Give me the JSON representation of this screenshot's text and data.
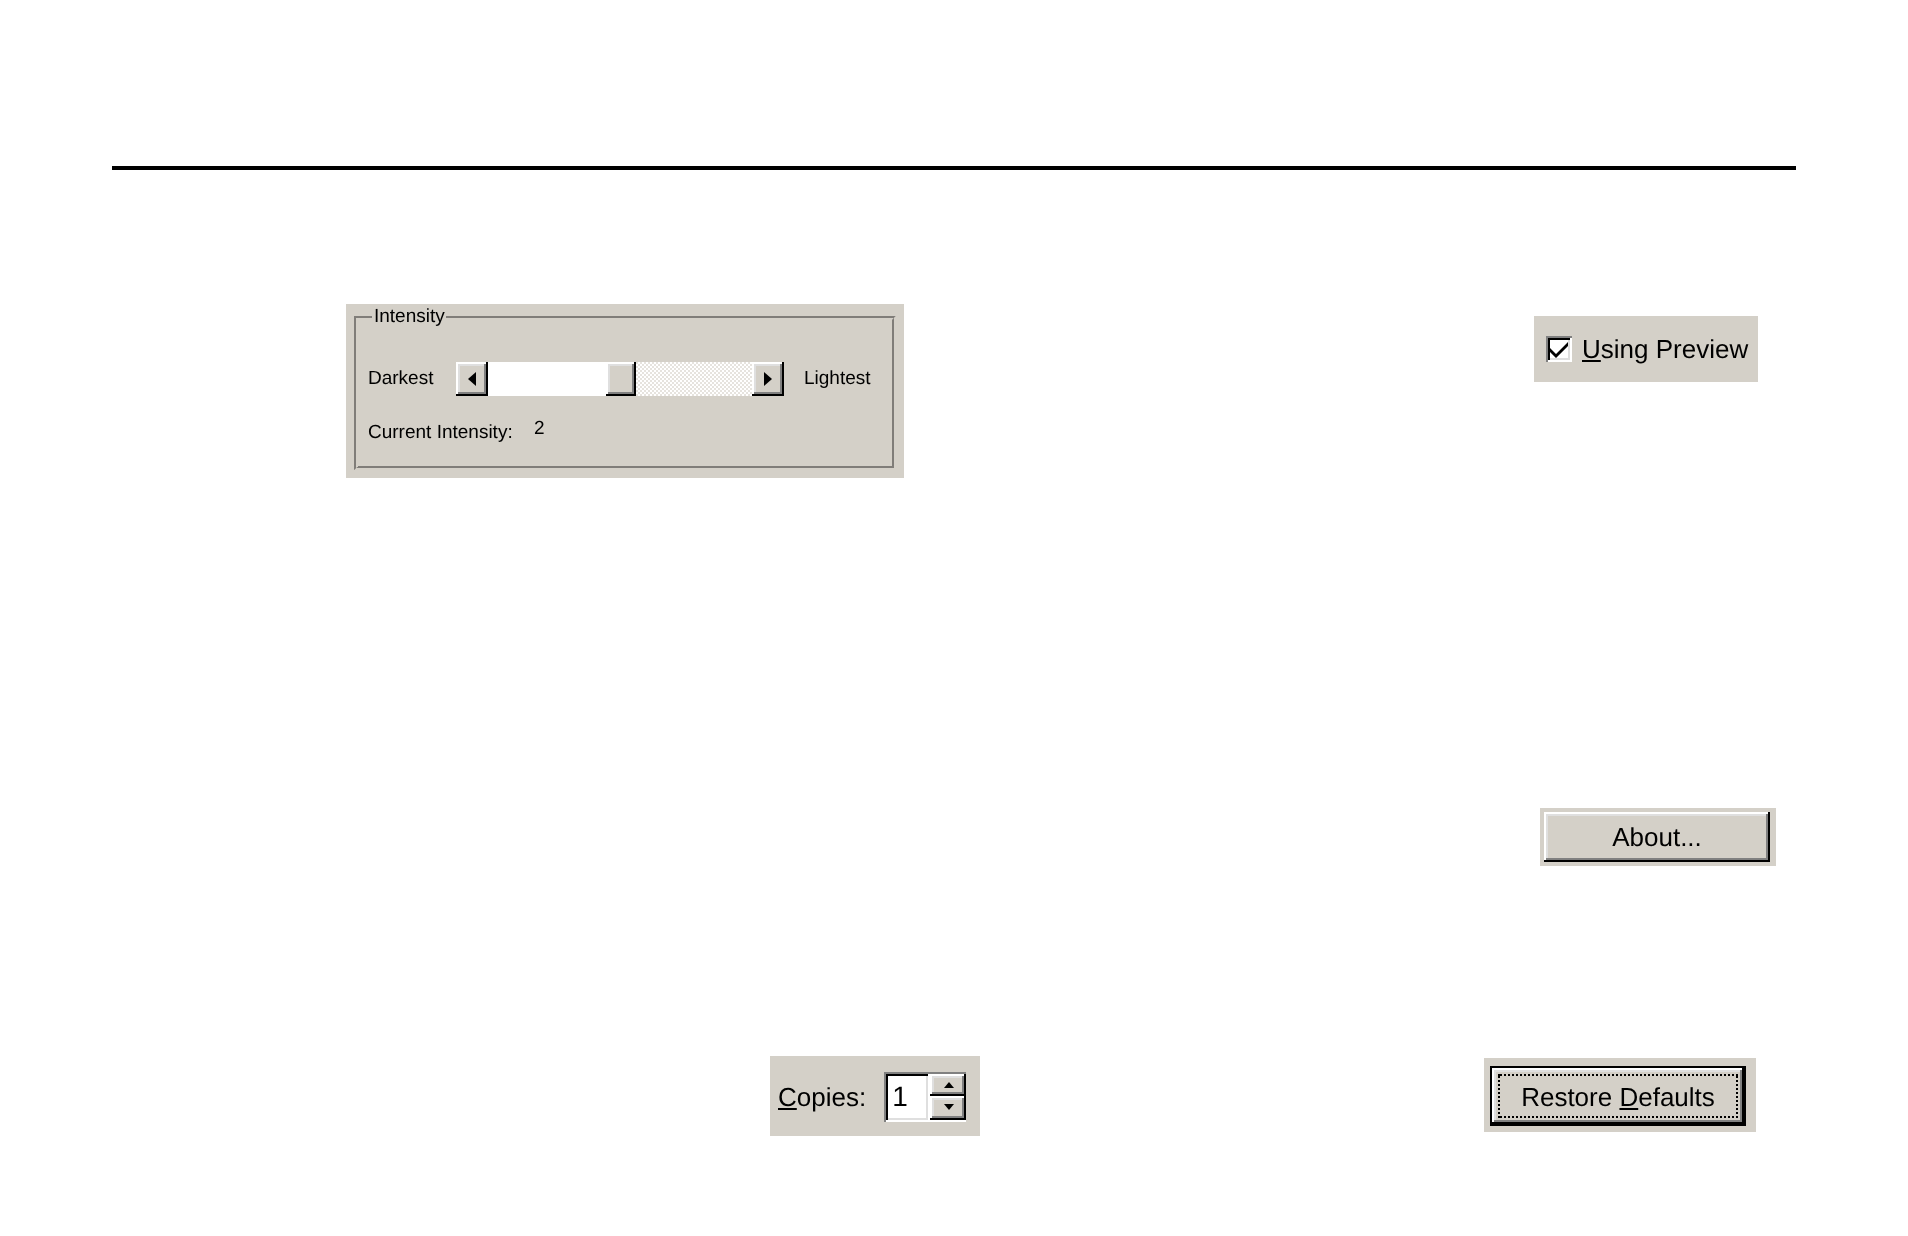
{
  "intensity": {
    "title": "Intensity",
    "min_label": "Darkest",
    "max_label": "Lightest",
    "level": 0.5,
    "current_label": "Current Intensity:",
    "current_value": "2"
  },
  "preview_checkbox": {
    "label": [
      {
        "text": "U",
        "underlined": true
      },
      {
        "text": "sing Preview",
        "underlined": false
      }
    ],
    "checked": true
  },
  "about_button": {
    "label": "About...",
    "default": false,
    "focused": false
  },
  "copies": {
    "label": [
      {
        "text": "C",
        "underlined": true
      },
      {
        "text": "opies:",
        "underlined": false
      }
    ],
    "value": "1"
  },
  "restore_button": {
    "label": [
      {
        "text": "Restore ",
        "underlined": false
      },
      {
        "text": "D",
        "underlined": true
      },
      {
        "text": "efaults",
        "underlined": false
      }
    ],
    "default": true,
    "focused": true
  }
}
